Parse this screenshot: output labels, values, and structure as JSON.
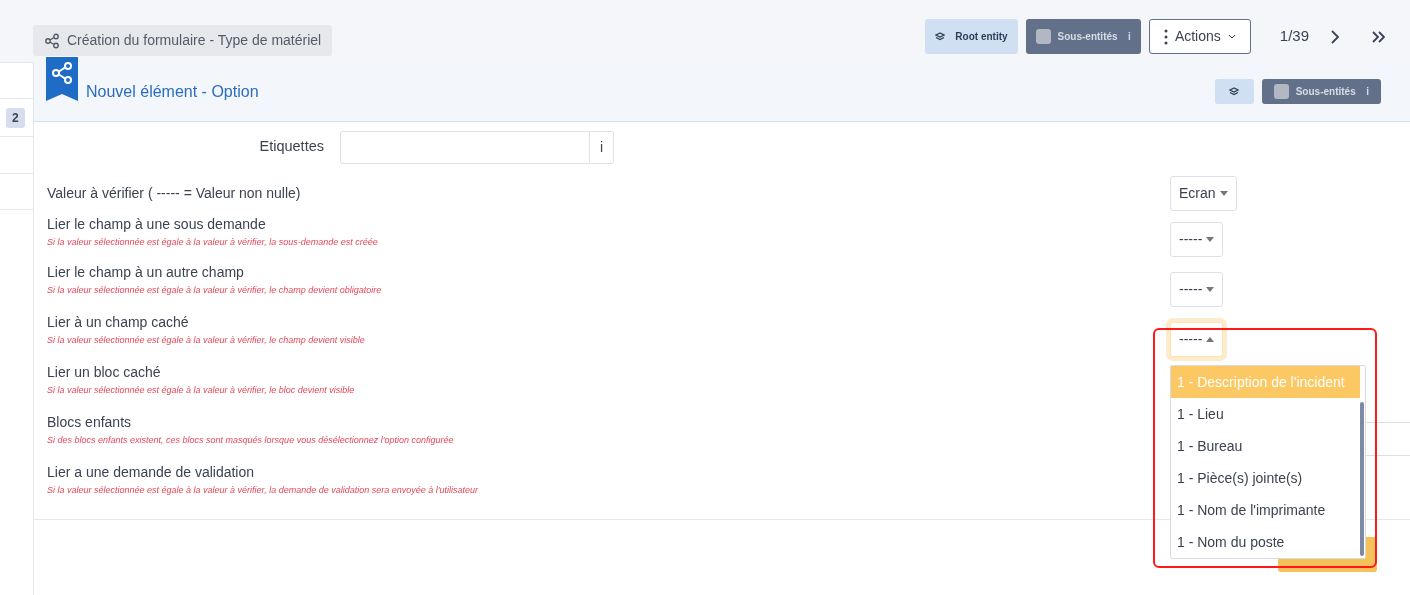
{
  "toolbar": {
    "breadcrumb": "Création du formulaire - Type de matériel",
    "root_entity": "Root entity",
    "sub_entities": {
      "label": "Sous-entités",
      "info": "i",
      "checked": false
    },
    "actions": "Actions",
    "pager": "1/39"
  },
  "sidebar": {
    "badge": "2"
  },
  "panel": {
    "title": "Nouvel élément - Option",
    "sub_entities": {
      "label": "Sous-entités",
      "info": "i",
      "checked": false
    }
  },
  "form": {
    "tags": {
      "label": "Etiquettes",
      "info": "i"
    },
    "value_check": {
      "label": "Valeur à vérifier ( ----- = Valeur non nulle)",
      "value": "Ecran"
    },
    "links": [
      {
        "label": "Lier le champ à une sous demande",
        "hint": "Si la valeur sélectionnée est égale à la valeur à vérifier, la sous-demande est créée",
        "kind": "select",
        "value": "-----",
        "expanded": false
      },
      {
        "label": "Lier le champ à un autre champ",
        "hint": "Si la valeur sélectionnée est égale à la valeur à vérifier, le champ devient obligatoire",
        "kind": "select",
        "value": "-----",
        "expanded": false
      },
      {
        "label": "Lier à un champ caché",
        "hint": "Si la valeur sélectionnée est égale à la valeur à vérifier, le champ devient visible",
        "kind": "select",
        "value": "-----",
        "expanded": true
      },
      {
        "label": "Lier un bloc caché",
        "hint": "Si la valeur sélectionnée est égale à la valeur à vérifier, le bloc devient visible",
        "kind": "covered"
      },
      {
        "label": "Blocs enfants",
        "hint": "Si des blocs enfants existent, ces blocs sont masqués lorsque vous désélectionnez l'option configurée",
        "kind": "field"
      },
      {
        "label": "Lier a une demande de validation",
        "hint": "Si la valeur sélectionnée est égale à la valeur à vérifier, la demande de validation sera envoyée à l'utilisateur",
        "kind": "covered"
      }
    ]
  },
  "dropdown": {
    "options": [
      {
        "label": "1 - Description de l'incident",
        "selected": true
      },
      {
        "label": "1 - Lieu",
        "selected": false
      },
      {
        "label": "1 - Bureau",
        "selected": false
      },
      {
        "label": "1 - Pièce(s) jointe(s)",
        "selected": false
      },
      {
        "label": "1 - Nom de l'imprimante",
        "selected": false
      },
      {
        "label": "1 - Nom du poste",
        "selected": false
      }
    ]
  }
}
